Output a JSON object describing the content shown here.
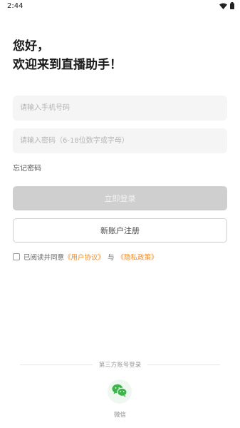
{
  "status_bar": {
    "time": "2:44",
    "icons": [
      "wifi-icon",
      "battery-icon"
    ]
  },
  "greeting": {
    "line1": "您好，",
    "line2": "欢迎来到直播助手！"
  },
  "form": {
    "phone_placeholder": "请输入手机号码",
    "password_placeholder": "请输入密码（6-18位数字或字母）",
    "forgot_password": "忘记密码"
  },
  "buttons": {
    "login": "立即登录",
    "register": "新账户注册"
  },
  "agreement": {
    "prefix": "已阅读并同意",
    "user_agreement": "《用户协议》",
    "and": "与",
    "privacy_policy": "《隐私政策》"
  },
  "third_party": {
    "label": "第三方账号登录",
    "wechat_label": "微信"
  },
  "colors": {
    "accent": "#f08a24",
    "wechat_green": "#3bb54a",
    "disabled_button": "#cfcfcf"
  }
}
